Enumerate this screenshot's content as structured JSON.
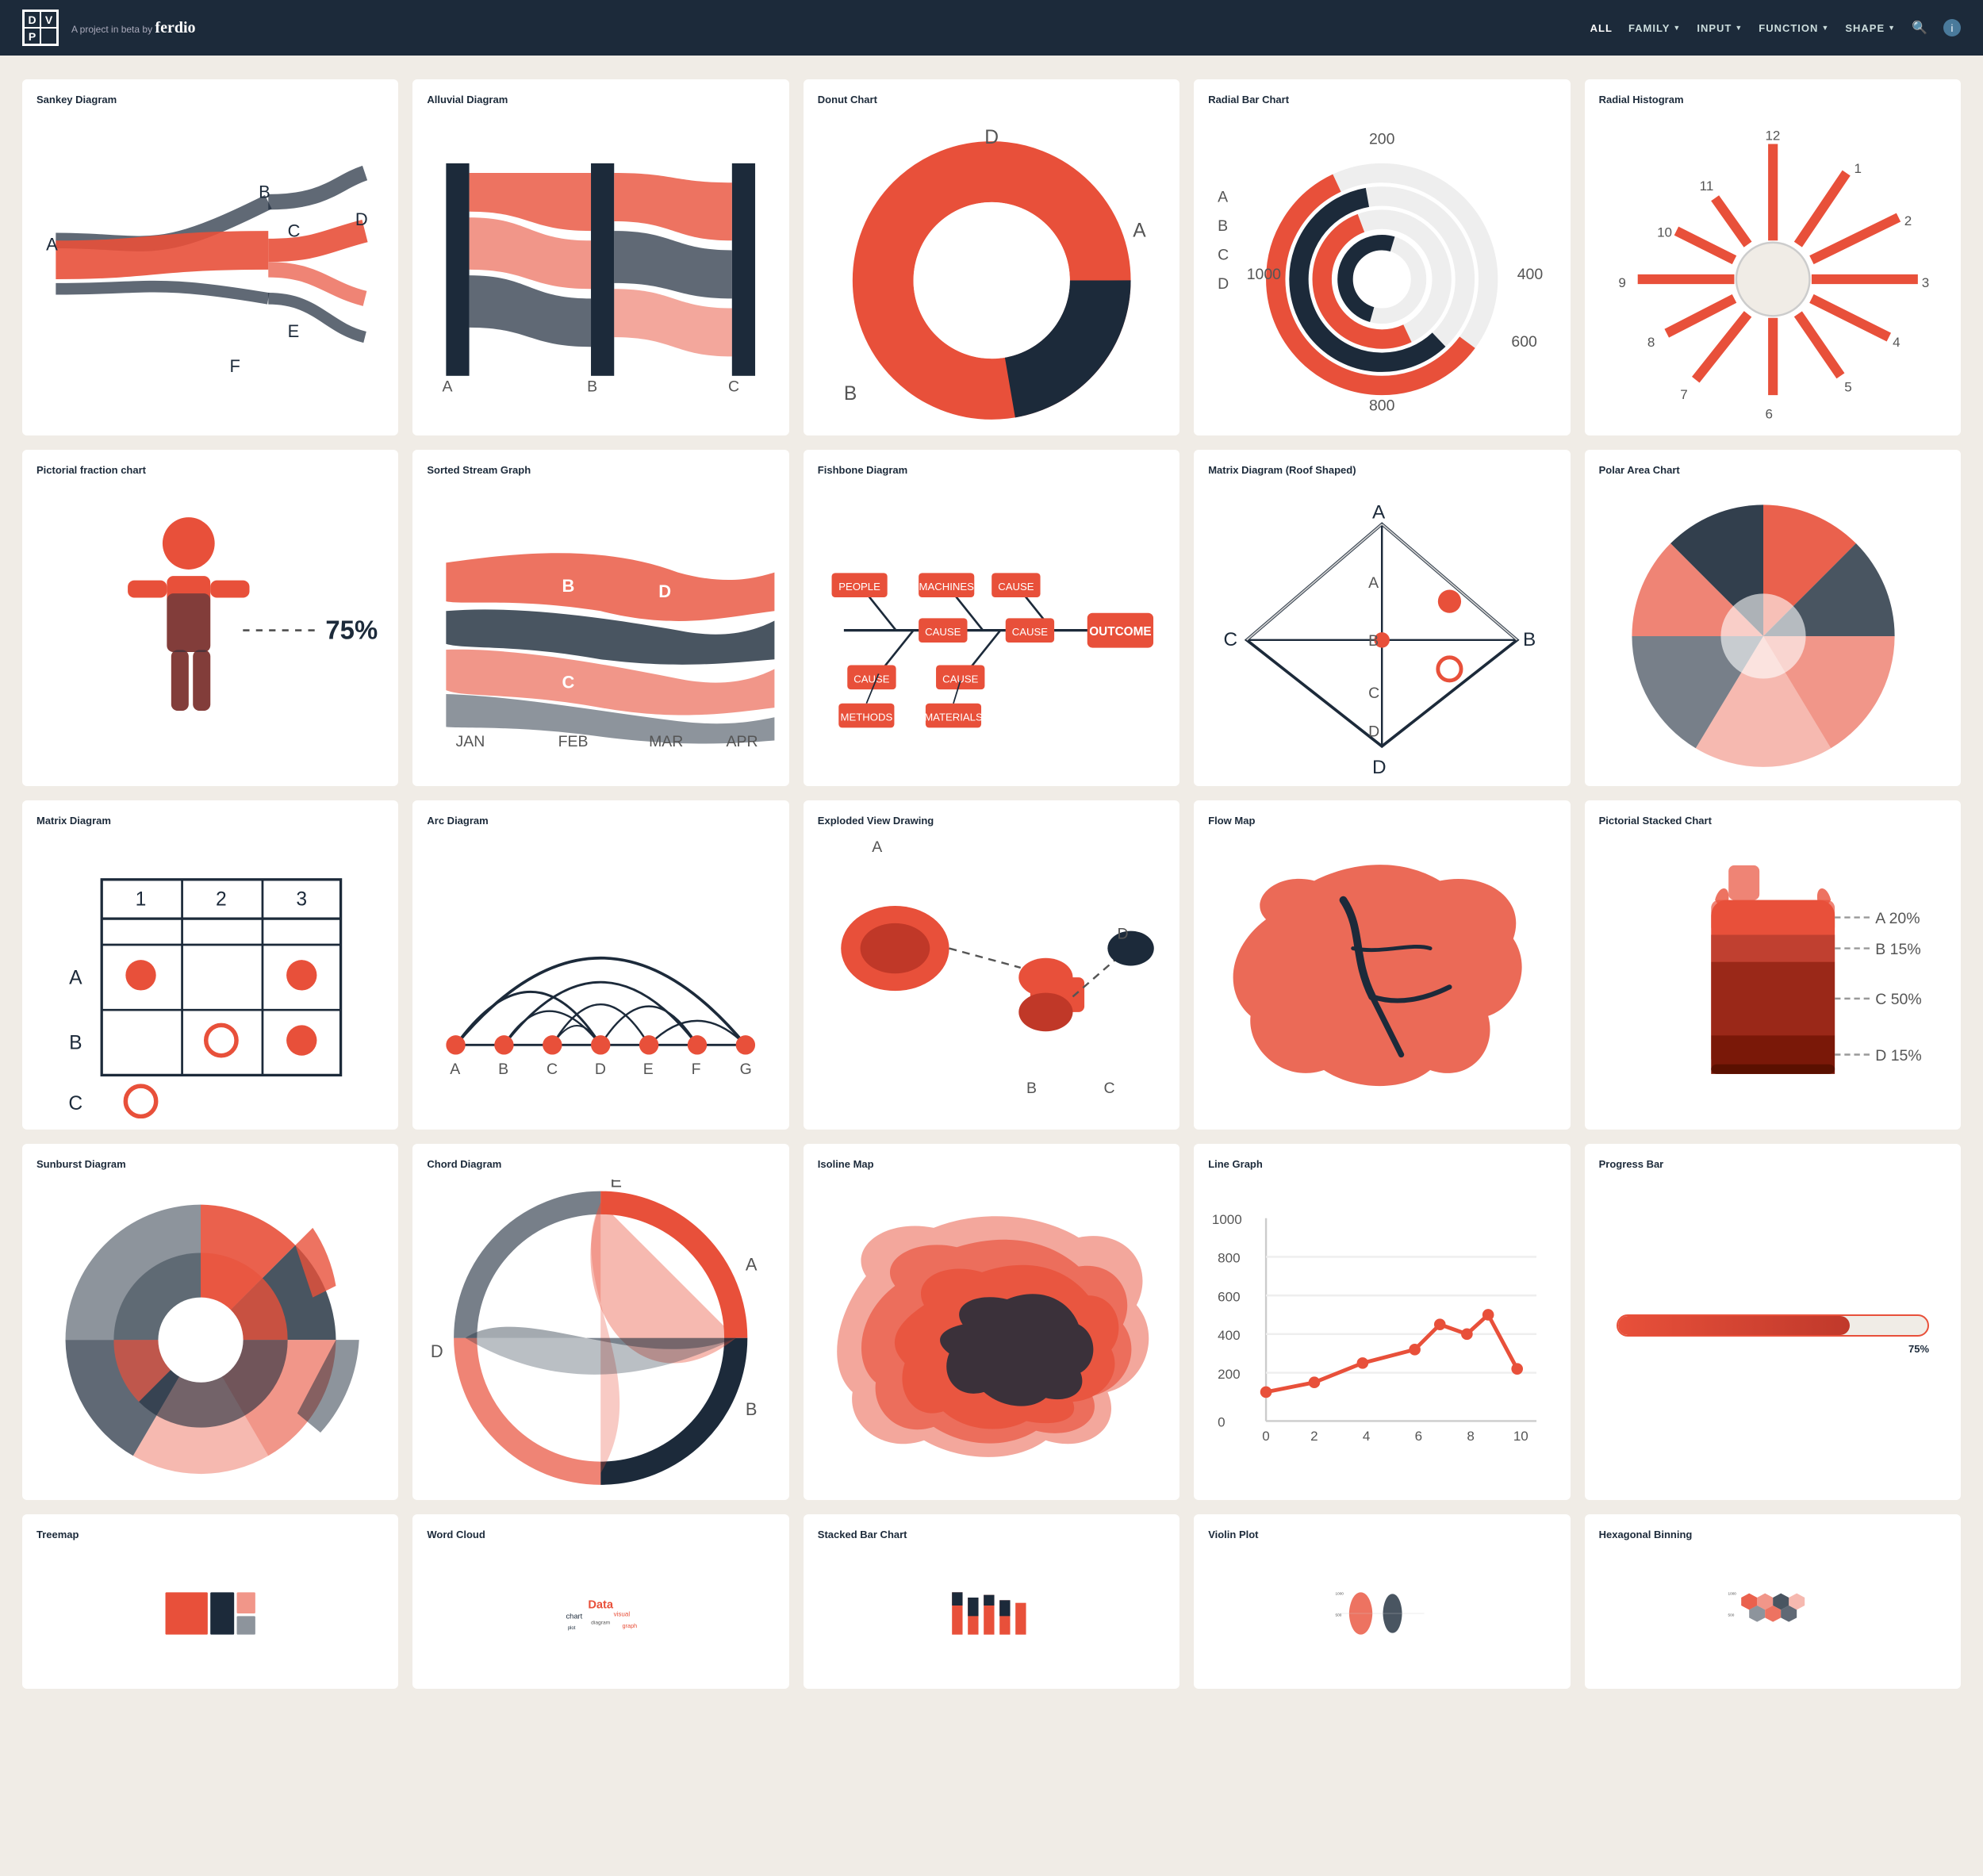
{
  "header": {
    "logo": {
      "d": "D",
      "v": "V",
      "p": "P"
    },
    "tagline": "A project in beta by",
    "brand": "ferdio",
    "nav": [
      {
        "label": "ALL",
        "active": true,
        "has_arrow": false
      },
      {
        "label": "FAMILY",
        "active": false,
        "has_arrow": true
      },
      {
        "label": "INPUT",
        "active": false,
        "has_arrow": true
      },
      {
        "label": "FUNCTION",
        "active": false,
        "has_arrow": true
      },
      {
        "label": "SHAPE",
        "active": false,
        "has_arrow": true
      }
    ]
  },
  "cards": [
    {
      "id": "sankey",
      "title": "Sankey Diagram"
    },
    {
      "id": "alluvial",
      "title": "Alluvial Diagram"
    },
    {
      "id": "donut",
      "title": "Donut Chart"
    },
    {
      "id": "radial-bar",
      "title": "Radial Bar Chart"
    },
    {
      "id": "radial-hist",
      "title": "Radial Histogram"
    },
    {
      "id": "pictorial-fraction",
      "title": "Pictorial fraction chart"
    },
    {
      "id": "sorted-stream",
      "title": "Sorted Stream Graph"
    },
    {
      "id": "fishbone",
      "title": "Fishbone Diagram"
    },
    {
      "id": "matrix-roof",
      "title": "Matrix Diagram (Roof Shaped)"
    },
    {
      "id": "polar-area",
      "title": "Polar Area Chart"
    },
    {
      "id": "matrix",
      "title": "Matrix Diagram"
    },
    {
      "id": "arc",
      "title": "Arc Diagram"
    },
    {
      "id": "exploded",
      "title": "Exploded View Drawing"
    },
    {
      "id": "flow-map",
      "title": "Flow Map"
    },
    {
      "id": "pictorial-stacked",
      "title": "Pictorial Stacked Chart"
    },
    {
      "id": "sunburst",
      "title": "Sunburst Diagram"
    },
    {
      "id": "chord",
      "title": "Chord Diagram"
    },
    {
      "id": "isoline",
      "title": "Isoline Map"
    },
    {
      "id": "line-graph",
      "title": "Line Graph"
    },
    {
      "id": "progress-bar",
      "title": "Progress Bar"
    },
    {
      "id": "treemap",
      "title": "Treemap"
    },
    {
      "id": "word-cloud",
      "title": "Word Cloud"
    },
    {
      "id": "stacked-bar",
      "title": "Stacked Bar Chart"
    },
    {
      "id": "violin",
      "title": "Violin Plot"
    },
    {
      "id": "hex-binning",
      "title": "Hexagonal Binning"
    }
  ],
  "progress": {
    "percent": 75,
    "label": "75%"
  },
  "pictorial_fraction": {
    "percent": "75%"
  },
  "pictorial_stacked": {
    "legend": [
      {
        "label": "A",
        "value": "20%"
      },
      {
        "label": "B",
        "value": "15%"
      },
      {
        "label": "C",
        "value": "50%"
      },
      {
        "label": "D",
        "value": "15%"
      }
    ]
  },
  "matrix_roof": {
    "rows": [
      "A",
      "B",
      "C",
      "D"
    ]
  },
  "matrix": {
    "cols": [
      "1",
      "2",
      "3"
    ],
    "rows": [
      "A",
      "B",
      "C"
    ]
  },
  "arc": {
    "nodes": [
      "A",
      "B",
      "C",
      "D",
      "E",
      "F",
      "G"
    ]
  },
  "fishbone": {
    "labels": [
      "PEOPLE",
      "MACHINES",
      "CAUSE",
      "CAUSE",
      "CAUSE",
      "CAUSE",
      "CAUSE",
      "OUTCOME",
      "METHODS",
      "MATERIALS"
    ]
  },
  "line_graph": {
    "x_labels": [
      "0",
      "2",
      "4",
      "6",
      "8",
      "10"
    ],
    "y_labels": [
      "0",
      "200",
      "400",
      "600",
      "800",
      "1000"
    ]
  }
}
